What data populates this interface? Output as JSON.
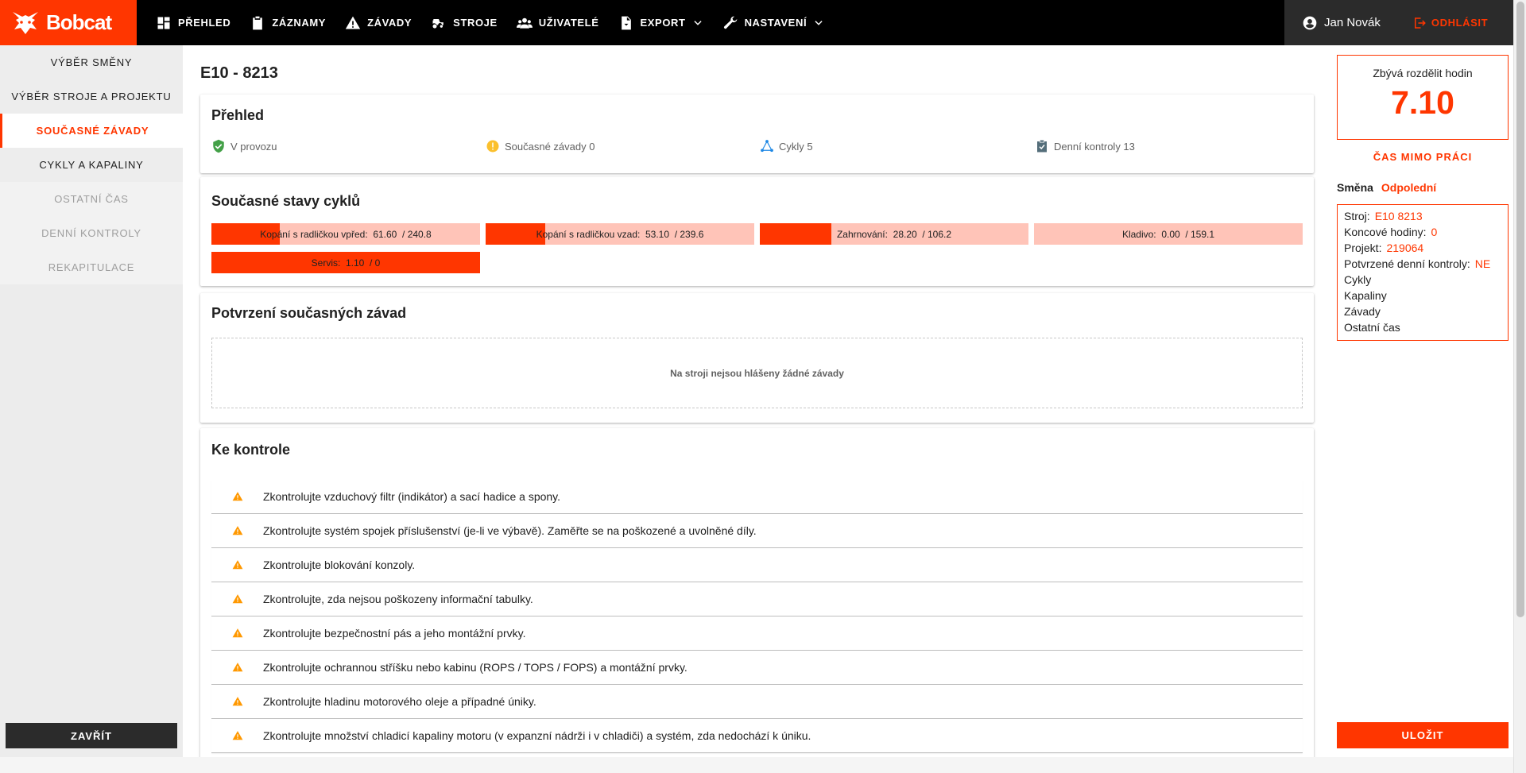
{
  "brand": {
    "name": "Bobcat",
    "accent": "#ff3600"
  },
  "nav": {
    "items": [
      {
        "label": "PŘEHLED",
        "icon": "dashboard-icon"
      },
      {
        "label": "ZÁZNAMY",
        "icon": "clipboard-icon"
      },
      {
        "label": "ZÁVADY",
        "icon": "warning-icon"
      },
      {
        "label": "STROJE",
        "icon": "tractor-icon"
      },
      {
        "label": "UŽIVATELÉ",
        "icon": "users-icon"
      },
      {
        "label": "EXPORT",
        "icon": "file-export-icon"
      },
      {
        "label": "NASTAVENÍ",
        "icon": "wrench-icon"
      }
    ],
    "user_name": "Jan Novák",
    "logout_label": "ODHLÁSIT"
  },
  "sidebar": {
    "items": [
      {
        "label": "VÝBĚR SMĚNY",
        "state": "normal"
      },
      {
        "label": "VÝBĚR STROJE A PROJEKTU",
        "state": "normal"
      },
      {
        "label": "SOUČASNÉ ZÁVADY",
        "state": "active"
      },
      {
        "label": "CYKLY A KAPALINY",
        "state": "normal"
      },
      {
        "label": "OSTATNÍ ČAS",
        "state": "disabled"
      },
      {
        "label": "DENNÍ KONTROLY",
        "state": "disabled"
      },
      {
        "label": "REKAPITULACE",
        "state": "disabled"
      }
    ],
    "close_label": "ZAVŘÍT"
  },
  "main": {
    "machine_title": "E10 - 8213",
    "overview": {
      "title": "Přehled",
      "items": [
        {
          "label": "V provozu",
          "icon": "shield-check-icon"
        },
        {
          "label": "Současné závady 0",
          "icon": "alert-circle-icon"
        },
        {
          "label": "Cykly 5",
          "icon": "graph-icon"
        },
        {
          "label": "Denní kontroly 13",
          "icon": "clipboard-check-icon"
        }
      ]
    },
    "cycles": {
      "title": "Současné stavy cyklů",
      "bars": [
        {
          "label": "Kopání s radličkou vpřed:  61.60  / 240.8",
          "value": 61.6,
          "max": 240.8
        },
        {
          "label": "Kopání s radličkou vzad:  53.10  / 239.6",
          "value": 53.1,
          "max": 239.6
        },
        {
          "label": "Zahrnování:  28.20  / 106.2",
          "value": 28.2,
          "max": 106.2
        },
        {
          "label": "Kladivo:  0.00  / 159.1",
          "value": 0.0,
          "max": 159.1
        },
        {
          "label": "Servis:  1.10  / 0",
          "value": 1.1,
          "max": 0
        }
      ]
    },
    "defects": {
      "title": "Potvrzení současných závad",
      "empty_text": "Na stroji nejsou hlášeny žádné závady"
    },
    "checks": {
      "title": "Ke kontrole",
      "items": [
        "Zkontrolujte vzduchový filtr (indikátor) a sací hadice a spony.",
        "Zkontrolujte systém spojek příslušenství (je-li ve výbavě). Zaměřte se na poškozené a uvolněné díly.",
        "Zkontrolujte blokování konzoly.",
        "Zkontrolujte, zda nejsou poškozeny informační tabulky.",
        "Zkontrolujte bezpečnostní pás a jeho montážní prvky.",
        "Zkontrolujte ochrannou stříšku nebo kabinu (ROPS / TOPS / FOPS) a montážní prvky.",
        "Zkontrolujte hladinu motorového oleje a případné úniky.",
        "Zkontrolujte množství chladicí kapaliny motoru (v expanzní nádrži i v chladiči) a systém, zda nedochází k úniku."
      ]
    }
  },
  "right_panel": {
    "hours_label": "Zbývá rozdělit hodin",
    "hours_value": "7.10",
    "offwork_label": "ČAS MIMO PRÁCI",
    "shift_label": "Směna",
    "shift_value": "Odpolední",
    "info": {
      "machine_label": "Stroj:",
      "machine_value": "E10 8213",
      "end_hours_label": "Koncové hodiny:",
      "end_hours_value": "0",
      "project_label": "Projekt:",
      "project_value": "219064",
      "daily_label": "Potvrzené denní kontroly:",
      "daily_value": "NE",
      "cycles_label": "Cykly",
      "fluids_label": "Kapaliny",
      "defects_label": "Závady",
      "other_label": "Ostatní čas"
    },
    "save_label": "ULOŽIT"
  }
}
